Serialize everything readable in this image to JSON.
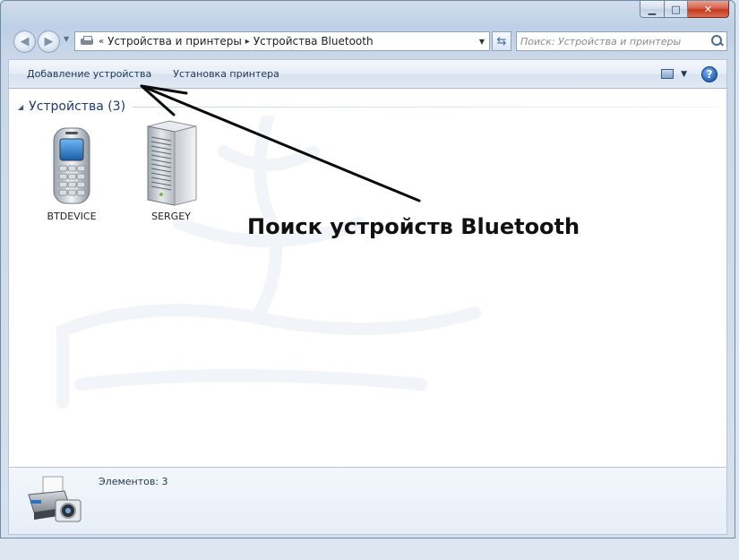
{
  "window": {
    "caption_buttons": {
      "minimize": "▁",
      "maximize": "□",
      "close": "✕"
    }
  },
  "nav": {
    "back_icon": "back-arrow-icon",
    "forward_icon": "forward-arrow-icon",
    "crumb_prefix": "«",
    "breadcrumbs": [
      "Устройства и принтеры",
      "Устройства Bluetooth"
    ],
    "refresh_icon": "refresh-icon"
  },
  "search": {
    "placeholder": "Поиск: Устройства и принтеры"
  },
  "toolbar": {
    "add_device": "Добавление устройства",
    "install_printer": "Установка принтера",
    "help": "?"
  },
  "group": {
    "title": "Устройства (3)"
  },
  "devices": [
    {
      "name": "BTDEVICE",
      "icon": "mobile-phone-icon"
    },
    {
      "name": "SERGEY",
      "icon": "computer-tower-icon"
    }
  ],
  "annotation": {
    "text": "Поиск устройств Bluetooth"
  },
  "details": {
    "count_text": "Элементов: 3",
    "icon": "printer-camera-icon"
  },
  "colors": {
    "accent": "#1e3a70",
    "window_frame": "#6f8aa8",
    "close_button": "#c43a1f"
  }
}
